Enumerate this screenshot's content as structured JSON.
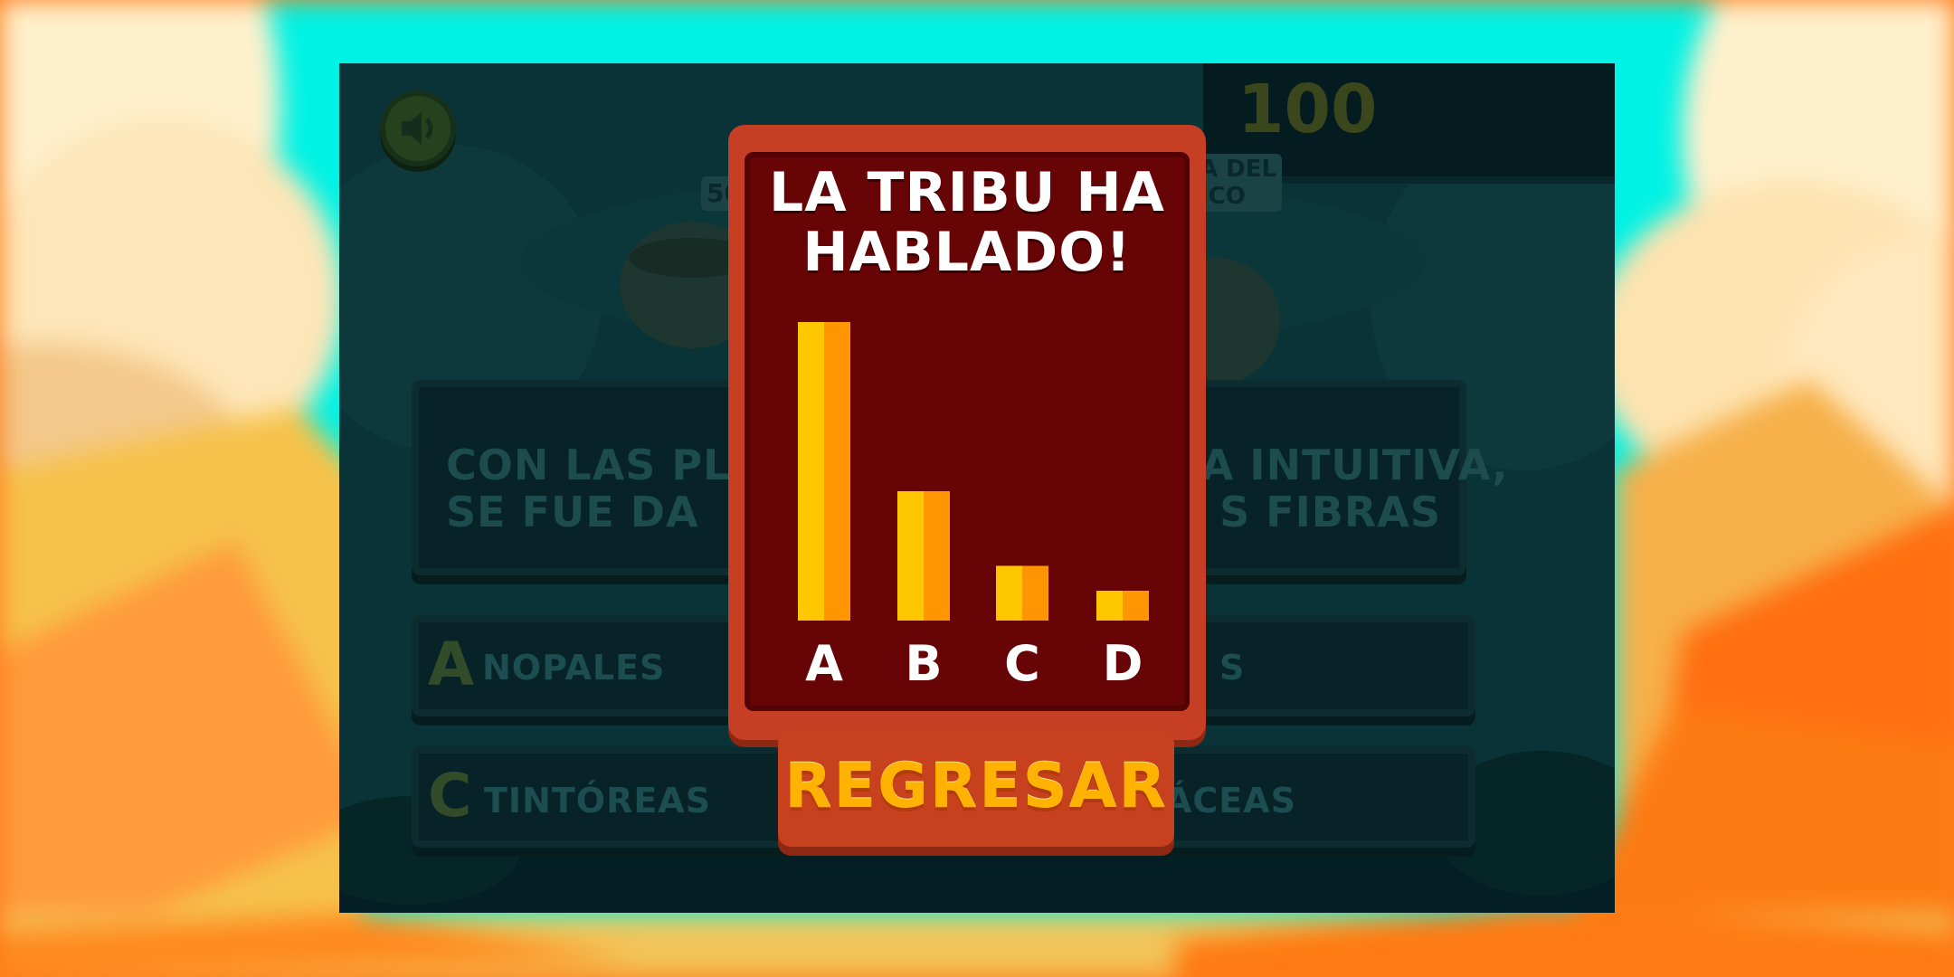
{
  "colors": {
    "sky": "#00f5e6",
    "modal_border": "#c63f24",
    "modal_fill": "#670405",
    "bar_left": "#ffc700",
    "bar_right": "#ff9500",
    "button_text": "#ffb300"
  },
  "game": {
    "score": "100",
    "sound_icon": "speaker-icon",
    "tags": {
      "left": "50",
      "right": "A DEL\nICO"
    },
    "question_left": "CON LAS PLA\nSE FUE DA",
    "question_right": "CA INTUITIVA,\nS FIBRAS",
    "answers": {
      "a_letter": "A",
      "a_text": "NOPALES",
      "b_text": "S",
      "c_letter": "C",
      "c_text": "TINTÓREAS",
      "d_text": "ÁCEAS"
    }
  },
  "modal": {
    "title": "LA TRIBU HA HABLADO!",
    "back_button": "REGRESAR"
  },
  "chart_data": {
    "type": "bar",
    "categories": [
      "A",
      "B",
      "C",
      "D"
    ],
    "values": [
      60,
      26,
      11,
      6
    ],
    "ylim": [
      0,
      60
    ]
  }
}
